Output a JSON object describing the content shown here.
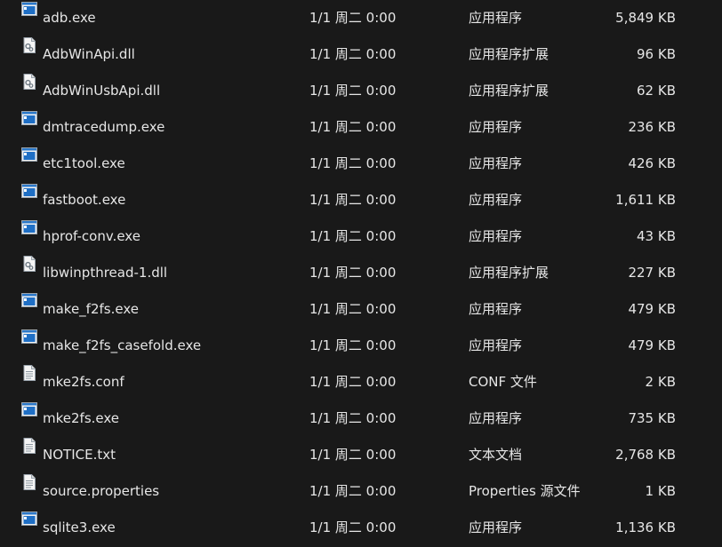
{
  "files": [
    {
      "name": "adb.exe",
      "date": "1/1 周二 0:00",
      "type": "应用程序",
      "size": "5,849 KB",
      "icon": "exe"
    },
    {
      "name": "AdbWinApi.dll",
      "date": "1/1 周二 0:00",
      "type": "应用程序扩展",
      "size": "96 KB",
      "icon": "dll"
    },
    {
      "name": "AdbWinUsbApi.dll",
      "date": "1/1 周二 0:00",
      "type": "应用程序扩展",
      "size": "62 KB",
      "icon": "dll"
    },
    {
      "name": "dmtracedump.exe",
      "date": "1/1 周二 0:00",
      "type": "应用程序",
      "size": "236 KB",
      "icon": "exe"
    },
    {
      "name": "etc1tool.exe",
      "date": "1/1 周二 0:00",
      "type": "应用程序",
      "size": "426 KB",
      "icon": "exe"
    },
    {
      "name": "fastboot.exe",
      "date": "1/1 周二 0:00",
      "type": "应用程序",
      "size": "1,611 KB",
      "icon": "exe"
    },
    {
      "name": "hprof-conv.exe",
      "date": "1/1 周二 0:00",
      "type": "应用程序",
      "size": "43 KB",
      "icon": "exe"
    },
    {
      "name": "libwinpthread-1.dll",
      "date": "1/1 周二 0:00",
      "type": "应用程序扩展",
      "size": "227 KB",
      "icon": "dll"
    },
    {
      "name": "make_f2fs.exe",
      "date": "1/1 周二 0:00",
      "type": "应用程序",
      "size": "479 KB",
      "icon": "exe"
    },
    {
      "name": "make_f2fs_casefold.exe",
      "date": "1/1 周二 0:00",
      "type": "应用程序",
      "size": "479 KB",
      "icon": "exe"
    },
    {
      "name": "mke2fs.conf",
      "date": "1/1 周二 0:00",
      "type": "CONF 文件",
      "size": "2 KB",
      "icon": "text"
    },
    {
      "name": "mke2fs.exe",
      "date": "1/1 周二 0:00",
      "type": "应用程序",
      "size": "735 KB",
      "icon": "exe"
    },
    {
      "name": "NOTICE.txt",
      "date": "1/1 周二 0:00",
      "type": "文本文档",
      "size": "2,768 KB",
      "icon": "text"
    },
    {
      "name": "source.properties",
      "date": "1/1 周二 0:00",
      "type": "Properties 源文件",
      "size": "1 KB",
      "icon": "text"
    },
    {
      "name": "sqlite3.exe",
      "date": "1/1 周二 0:00",
      "type": "应用程序",
      "size": "1,136 KB",
      "icon": "exe"
    }
  ]
}
